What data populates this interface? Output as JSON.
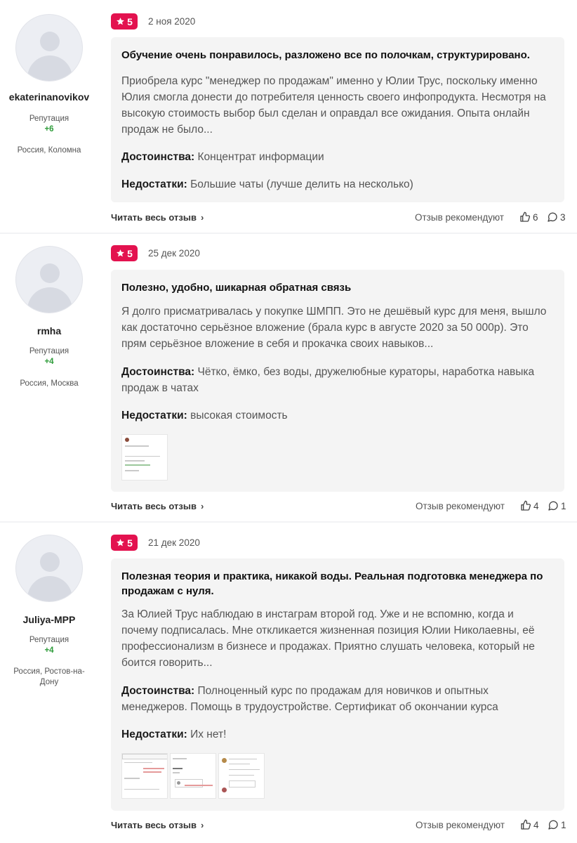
{
  "reviews": [
    {
      "user": {
        "username": "ekaterinanovikov",
        "reputation_label": "Репутация",
        "reputation_value": "+6",
        "location": "Россия, Коломна"
      },
      "rating": "5",
      "date": "2 ноя 2020",
      "title": "Обучение очень понравилось, разложено все по полочкам, структурировано.",
      "text": "Приобрела курс \"менеджер по продажам\" именно у Юлии Трус, поскольку именно Юлия смогла донести до потребителя ценность своего инфопродукта. Несмотря на высокую стоимость выбор был сделан и оправдал все ожидания. Опыта онлайн продаж не было...",
      "pros_label": "Достоинства:",
      "pros": "Концентрат информации",
      "cons_label": "Недостатки:",
      "cons": "Большие чаты (лучше делить на несколько)",
      "read_more": "Читать весь отзыв",
      "recommend_label": "Отзыв рекомендуют",
      "likes": "6",
      "comments": "3"
    },
    {
      "user": {
        "username": "rmha",
        "reputation_label": "Репутация",
        "reputation_value": "+4",
        "location": "Россия, Москва"
      },
      "rating": "5",
      "date": "25 дек 2020",
      "title": "Полезно, удобно, шикарная обратная связь",
      "text": "Я долго присматривалась у покупке ШМПП. Это не дешёвый курс для меня, вышло как достаточно серьёзное вложение (брала курс в августе 2020 за 50 000р). Это прям серьёзное вложение в себя и прокачка своих навыков...",
      "pros_label": "Достоинства:",
      "pros": "Чётко, ёмко, без воды, дружелюбные кураторы, наработка навыка продаж в чатах",
      "cons_label": "Недостатки:",
      "cons": "высокая стоимость",
      "read_more": "Читать весь отзыв",
      "recommend_label": "Отзыв рекомендуют",
      "likes": "4",
      "comments": "1"
    },
    {
      "user": {
        "username": "Juliya-MPP",
        "reputation_label": "Репутация",
        "reputation_value": "+4",
        "location": "Россия, Ростов-на-Дону"
      },
      "rating": "5",
      "date": "21 дек 2020",
      "title": "Полезная теория и практика, никакой воды. Реальная подготовка менеджера по продажам с нуля.",
      "text": "За Юлией Трус наблюдаю в инстаграм второй год. Уже и не вспомню, когда и почему подписалась. Мне откликается жизненная позиция Юлии Николаевны, её профессионализм в бизнесе и продажах. Приятно слушать человека, который не боится говорить...",
      "pros_label": "Достоинства:",
      "pros": "Полноценный курс по продажам для новичков и опытных менеджеров. Помощь в трудоустройстве. Сертификат об окончании курса",
      "cons_label": "Недостатки:",
      "cons": "Их нет!",
      "read_more": "Читать весь отзыв",
      "recommend_label": "Отзыв рекомендуют",
      "likes": "4",
      "comments": "1"
    }
  ],
  "colors": {
    "badge": "#e3124f",
    "reputation": "#2e9c3a",
    "card_bg": "#f4f4f4",
    "page_bg": "#f2f3f5"
  },
  "icons": [
    "star-icon",
    "thumbs-up-icon",
    "comment-icon",
    "chevron-right-icon",
    "avatar-placeholder"
  ]
}
